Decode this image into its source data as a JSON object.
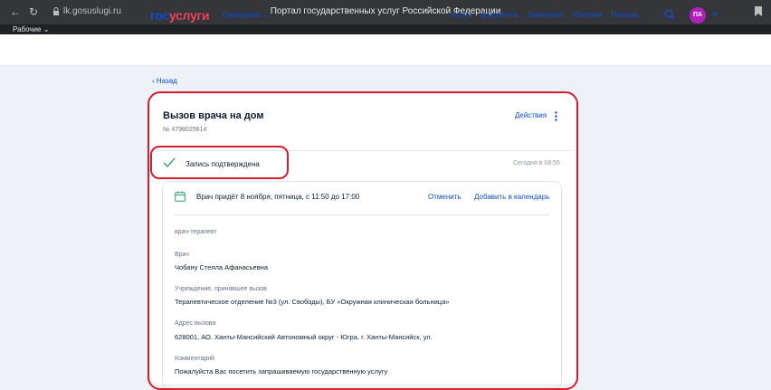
{
  "browser": {
    "url": "lk.gosuslugi.ru",
    "tab_title": "Портал государственных услуг Российской Федерации",
    "bookmarks_folder": "Рабочие"
  },
  "header": {
    "logo_part1": "гос",
    "logo_part2": "услуги",
    "audience": "Гражданам",
    "nav": [
      "Услуги",
      "Документы",
      "Заявления",
      "Платежи",
      "Помощь"
    ],
    "avatar_initials": "ПА",
    "avatar_color": "#b41ebd",
    "brand_blue": "#0d4cd3",
    "brand_red": "#ee3f58"
  },
  "back_link": "‹ Назад",
  "card": {
    "title": "Вызов врача на дом",
    "number": "№ 4798025614",
    "actions": "Действия",
    "status": "Запись подтверждена",
    "status_time": "Сегодня в 08:55",
    "visit_text": "Врач придёт 8 ноября, пятница, с 11:50 до 17:00",
    "cancel": "Отменить",
    "add_calendar": "Добавить в календарь",
    "specialty": "врач-терапевт",
    "fields": [
      {
        "label": "Врач",
        "value": "Чобану Стелла Афанасьевна"
      },
      {
        "label": "Учреждение, принявшее вызов",
        "value": "Терапевтическое отделение №3 (ул. Свободы), БУ «Окружная клиническая больница»"
      },
      {
        "label": "Адрес вызова",
        "value": "628001, АО. Ханты-Мансийский Автономный округ - Югра, г. Ханты-Мансийск, ул."
      },
      {
        "label": "Комментарий",
        "value": "Пожалуйста Вас посетить запрашиваемую государственную услугу"
      }
    ]
  },
  "highlight_color": "#d61e2e"
}
